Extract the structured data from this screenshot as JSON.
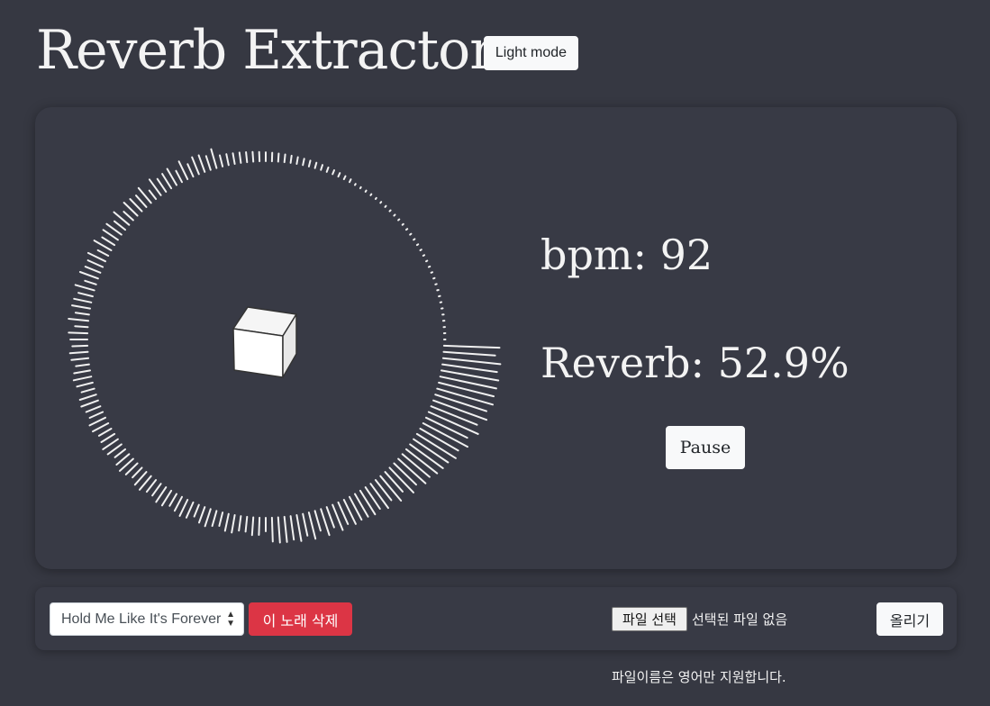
{
  "header": {
    "title": "Reverb Extractor",
    "mode_button": "Light mode"
  },
  "player": {
    "bpm_text": "bpm: 92",
    "reverb_text": "Reverb: 52.9%",
    "pause_button": "Pause"
  },
  "controls": {
    "selected_song": "Hold Me Like It's Forever",
    "delete_button": "이 노래 삭제",
    "file_button": "파일 선택",
    "file_status": "선택된 파일 없음",
    "upload_button": "올리기",
    "note": "파일이름은 영어만 지원합니다."
  },
  "colors": {
    "background": "#363842",
    "card": "#383a45",
    "danger": "#dc3545",
    "light": "#f8f9fa"
  },
  "icons": {
    "visualizer_center": "cube-icon",
    "select_arrow": "sort-arrows-icon"
  }
}
